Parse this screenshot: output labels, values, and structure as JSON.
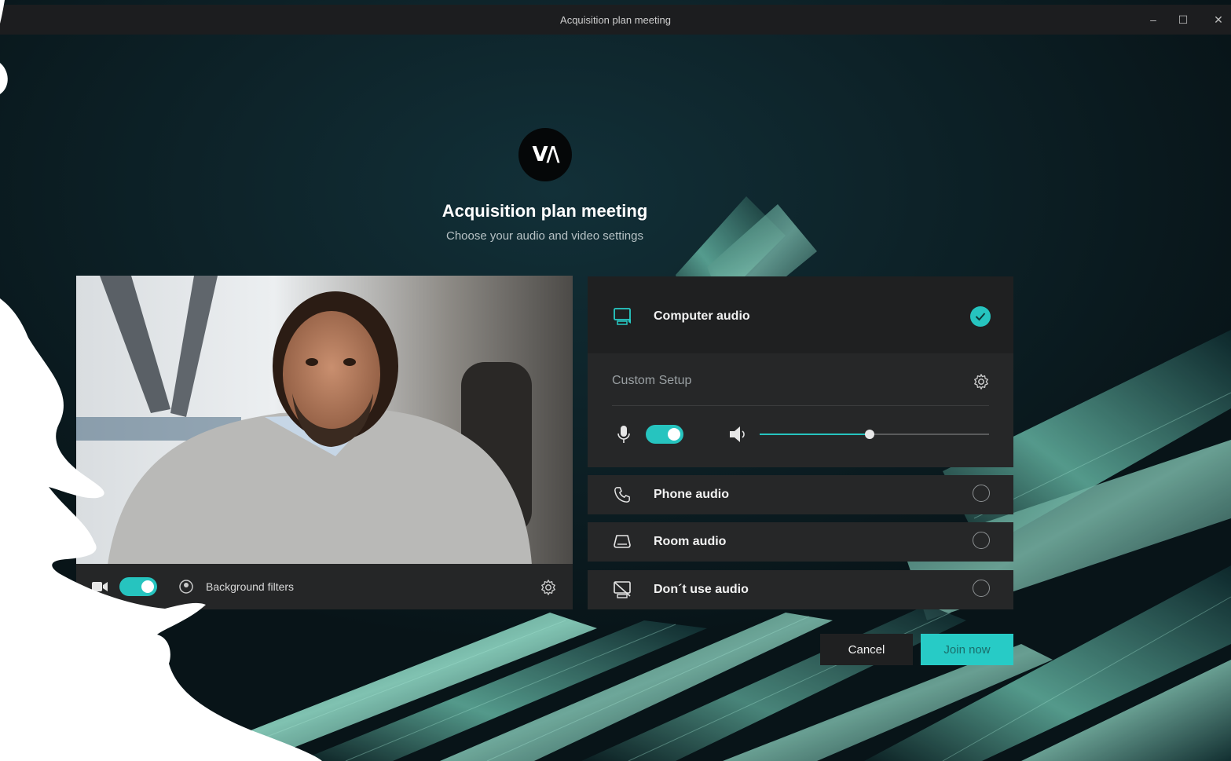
{
  "window": {
    "title": "Acquisition plan meeting",
    "minimize_glyph": "–",
    "maximize_glyph": "☐",
    "close_glyph": "✕"
  },
  "header": {
    "logo_text": "V/\\",
    "title": "Acquisition plan meeting",
    "subtitle": "Choose your audio and video settings"
  },
  "video": {
    "camera_icon": "video-camera-icon",
    "camera_on": true,
    "background_filters_label": "Background filters",
    "settings_icon": "gear-icon"
  },
  "audio": {
    "computer_audio": {
      "label": "Computer audio",
      "icon": "monitor-speaker-icon",
      "selected": true
    },
    "custom_setup_label": "Custom Setup",
    "mic_enabled": true,
    "speaker_volume": 0.48,
    "options": [
      {
        "label": "Phone audio",
        "icon": "phone-icon",
        "selected": false
      },
      {
        "label": "Room audio",
        "icon": "room-device-icon",
        "selected": false
      },
      {
        "label": "Don´t use audio",
        "icon": "no-audio-icon",
        "selected": false
      }
    ]
  },
  "actions": {
    "cancel_label": "Cancel",
    "join_label": "Join now"
  },
  "colors": {
    "accent": "#27cbc6",
    "panel": "#262728",
    "background": "#0a1b21"
  }
}
